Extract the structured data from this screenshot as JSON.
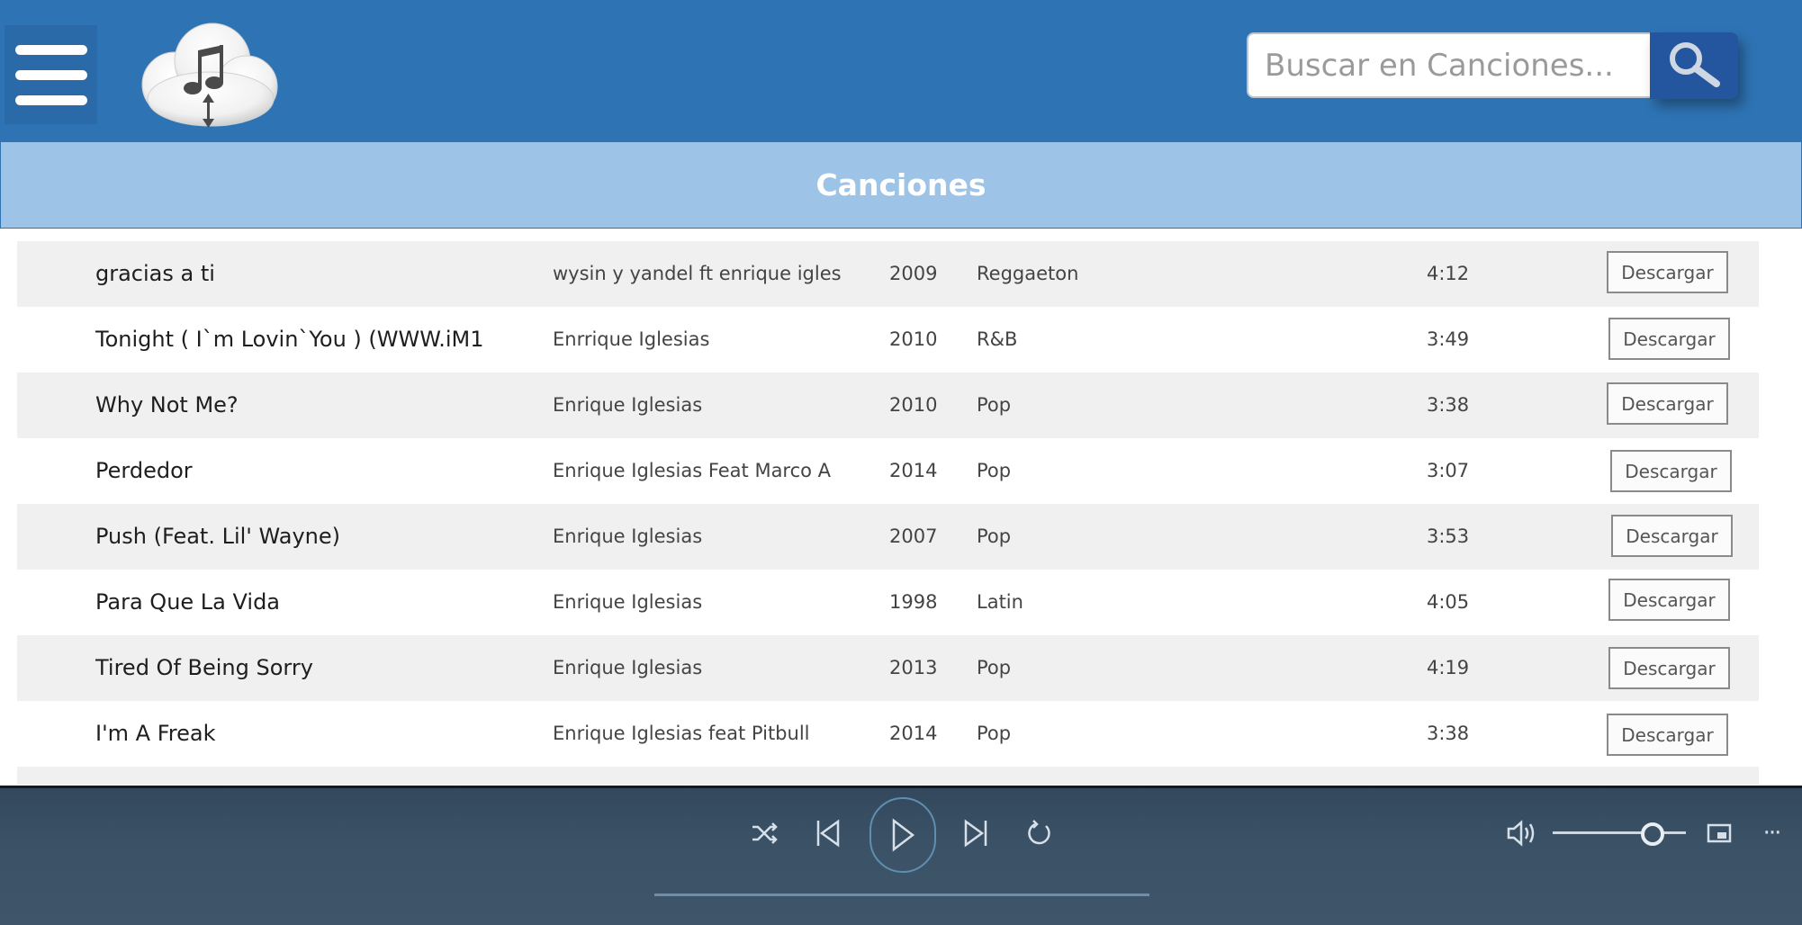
{
  "header": {
    "search_placeholder": "Buscar en Canciones..."
  },
  "page": {
    "title": "Canciones"
  },
  "songs": [
    {
      "title": "gracias a ti",
      "artist": "wysin y yandel ft enrique igles",
      "year": "2009",
      "genre": "Reggaeton",
      "duration": "4:12",
      "action": "Descargar"
    },
    {
      "title": "Tonight ( I`m Lovin`You ) (WWW.iM1",
      "artist": "Enrrique Iglesias",
      "year": "2010",
      "genre": "R&B",
      "duration": "3:49",
      "action": "Descargar"
    },
    {
      "title": "Why Not Me?",
      "artist": "Enrique Iglesias",
      "year": "2010",
      "genre": "Pop",
      "duration": "3:38",
      "action": "Descargar"
    },
    {
      "title": "Perdedor",
      "artist": "Enrique Iglesias  Feat Marco A",
      "year": "2014",
      "genre": "Pop",
      "duration": "3:07",
      "action": "Descargar"
    },
    {
      "title": "Push (Feat. Lil' Wayne)",
      "artist": "Enrique Iglesias",
      "year": "2007",
      "genre": "Pop",
      "duration": "3:53",
      "action": "Descargar"
    },
    {
      "title": "Para Que La Vida",
      "artist": "Enrique Iglesias",
      "year": "1998",
      "genre": "Latin",
      "duration": "4:05",
      "action": "Descargar"
    },
    {
      "title": "Tired Of Being Sorry",
      "artist": "Enrique Iglesias",
      "year": "2013",
      "genre": "Pop",
      "duration": "4:19",
      "action": "Descargar"
    },
    {
      "title": "I'm A Freak",
      "artist": "Enrique Iglesias feat Pitbull",
      "year": "2014",
      "genre": "Pop",
      "duration": "3:38",
      "action": "Descargar"
    }
  ],
  "player": {
    "more_label": "···",
    "volume_level": 0.75,
    "playback_progress": 0.0
  },
  "colors": {
    "header_bg": "#2e74b5",
    "title_bar_bg": "#9dc3e6",
    "search_button_bg": "#2456a0",
    "player_bg": "#3b5266",
    "row_shade": "#f0f0f0"
  },
  "icons": {
    "menu": "hamburger-menu-icon",
    "logo": "cloud-music-logo",
    "search": "search-icon",
    "shuffle": "shuffle-icon",
    "previous": "previous-track-icon",
    "play": "play-icon",
    "next": "next-track-icon",
    "repeat": "repeat-icon",
    "volume": "volume-icon",
    "miniplayer": "miniplayer-icon"
  }
}
